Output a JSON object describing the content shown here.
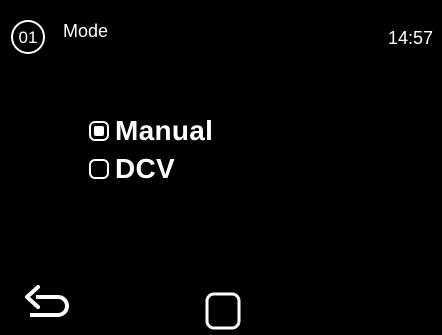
{
  "header": {
    "screen_number": "01",
    "title": "Mode",
    "time": "14:57"
  },
  "mode_options": [
    {
      "label": "Manual",
      "selected": true
    },
    {
      "label": "DCV",
      "selected": false
    }
  ],
  "navigation": {
    "back_icon": "back-arrow-icon",
    "home_icon": "home-square-icon"
  },
  "colors": {
    "background": "#000000",
    "foreground": "#ffffff"
  }
}
